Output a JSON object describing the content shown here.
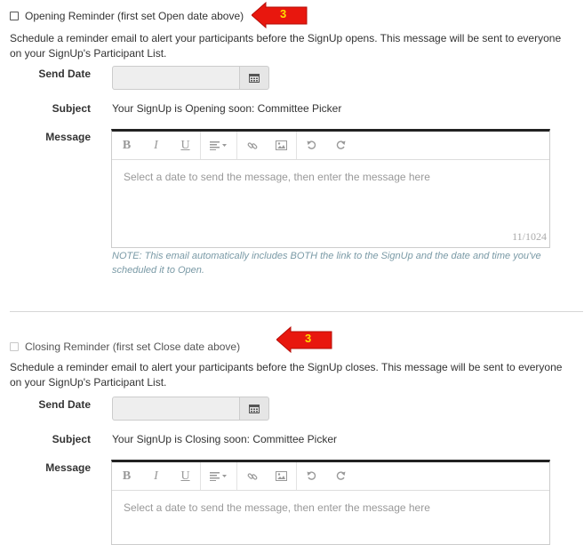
{
  "opening": {
    "checkbox_label": "Opening Reminder (first set Open date above)",
    "badge": "3",
    "description": "Schedule a reminder email to alert your participants before the SignUp opens. This message will be sent to everyone on your SignUp's Participant List.",
    "send_date_label": "Send Date",
    "send_date_value": "",
    "subject_label": "Subject",
    "subject_value": "Your SignUp is Opening soon: Committee Picker",
    "message_label": "Message",
    "placeholder": "Select a date to send the message, then enter the message here",
    "counter": "11/1024",
    "note": "NOTE: This email automatically includes BOTH the link to the SignUp and the date and time you've scheduled it to Open."
  },
  "closing": {
    "checkbox_label": "Closing Reminder (first set Close date above)",
    "badge": "3",
    "description": "Schedule a reminder email to alert your participants before the SignUp closes. This message will be sent to everyone on your SignUp's Participant List.",
    "send_date_label": "Send Date",
    "send_date_value": "",
    "subject_label": "Subject",
    "subject_value": "Your SignUp is Closing soon: Committee Picker",
    "message_label": "Message",
    "placeholder": "Select a date to send the message, then enter the message here"
  },
  "toolbar": {
    "bold": "B",
    "italic": "I",
    "underline": "U"
  },
  "colors": {
    "badge_red": "#e8170e",
    "badge_text": "#ffdd00",
    "note_text": "#7a9aa6"
  },
  "icons": [
    "calendar-icon",
    "bold-icon",
    "italic-icon",
    "underline-icon",
    "align-icon",
    "link-icon",
    "image-icon",
    "undo-icon",
    "redo-icon",
    "red-arrow-badge"
  ]
}
